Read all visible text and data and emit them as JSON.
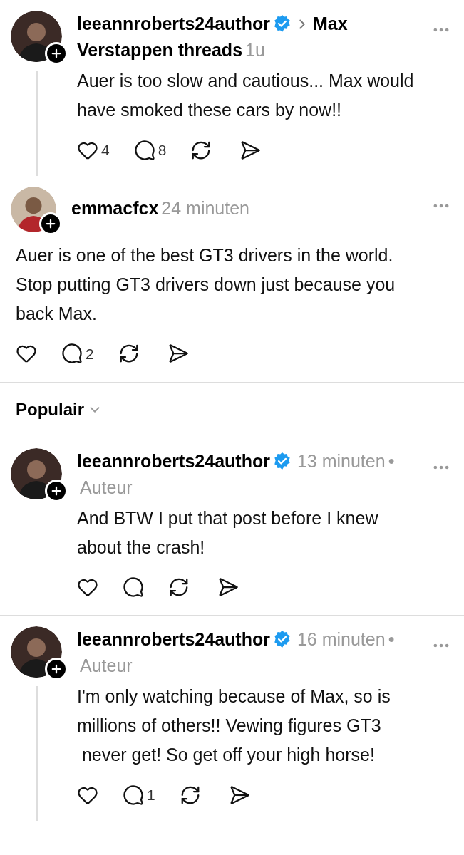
{
  "posts": [
    {
      "kind": "inset",
      "username": "leeannroberts24author",
      "verified": true,
      "thread_title_lines": [
        "Max",
        "Verstappen threads"
      ],
      "time": "1u",
      "thread_line": true,
      "divider_after": false,
      "text_lines": [
        "Auer is too slow and cautious... Max would",
        "have smoked these cars by now!!"
      ],
      "likes": "4",
      "replies": "8"
    },
    {
      "kind": "full",
      "username": "emmacfcx",
      "verified": false,
      "time": "24 minuten",
      "thread_line": false,
      "divider_after": true,
      "text_lines": [
        "Auer is one of the best GT3 drivers in the world.",
        "Stop putting GT3 drivers down just because you",
        "back Max."
      ],
      "replies": "2"
    }
  ],
  "sort": {
    "label": "Populair"
  },
  "replies": [
    {
      "kind": "inset",
      "username": "leeannroberts24author",
      "verified": true,
      "time": "13 minuten",
      "separator": "•",
      "author_tag": "Auteur",
      "thread_line": false,
      "divider_after": true,
      "text_lines": [
        "And BTW I put that post before I knew",
        "about the crash!"
      ]
    },
    {
      "kind": "inset",
      "username": "leeannroberts24author",
      "verified": true,
      "time": "16 minuten",
      "separator": "•",
      "author_tag": "Auteur",
      "thread_line": true,
      "divider_after": false,
      "text_lines": [
        "I'm only watching because of Max, so is",
        "millions of others!! Vewing figures GT3",
        " never get! So get off your high horse!"
      ],
      "replies": "1"
    }
  ]
}
